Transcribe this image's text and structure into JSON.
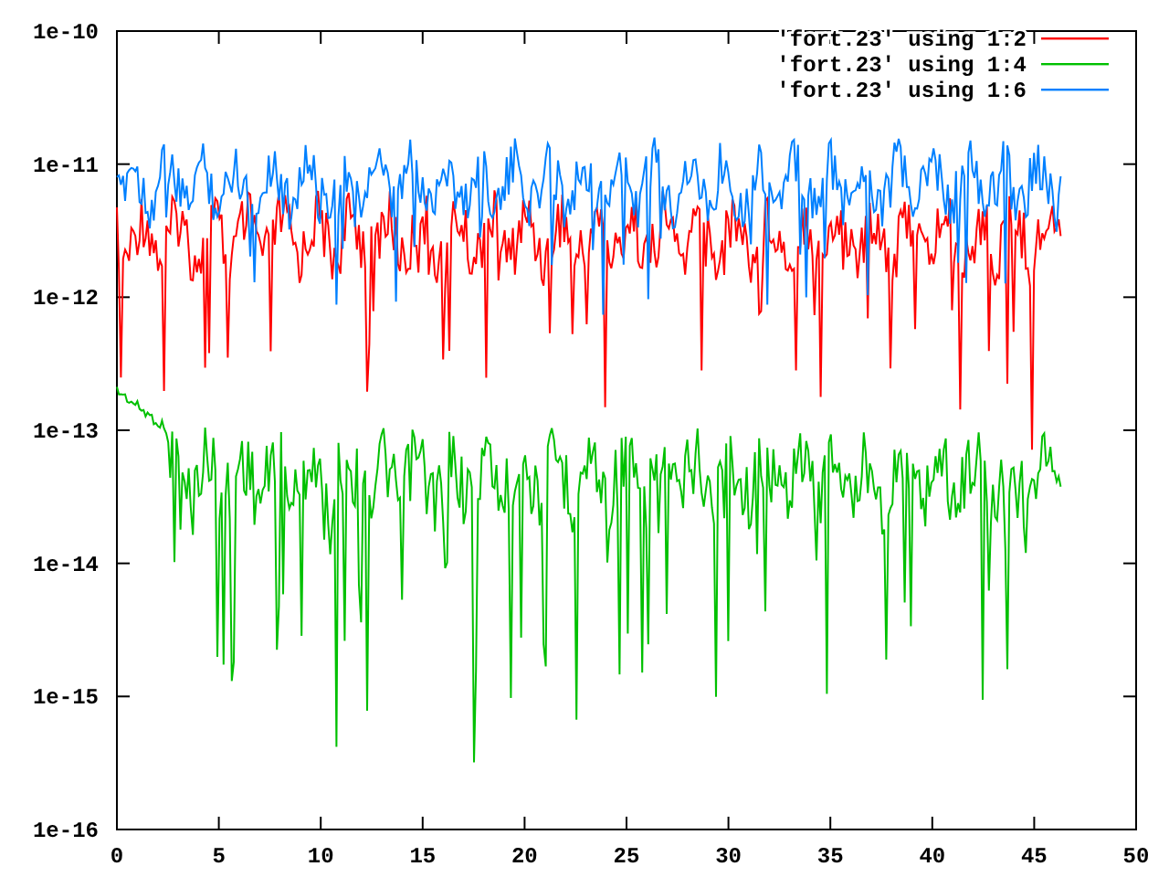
{
  "plot": {
    "y_tick_labels": [
      "1e-10",
      "1e-11",
      "1e-12",
      "1e-13",
      "1e-14",
      "1e-15",
      "1e-16"
    ],
    "x_tick_labels": [
      "0",
      "5",
      "10",
      "15",
      "20",
      "25",
      "30",
      "35",
      "40",
      "45",
      "50"
    ],
    "legend": [
      {
        "label": "'fort.23' using 1:2",
        "color": "#ff0000"
      },
      {
        "label": "'fort.23' using 1:4",
        "color": "#00c000"
      },
      {
        "label": "'fort.23' using 1:6",
        "color": "#0080ff"
      }
    ]
  }
}
